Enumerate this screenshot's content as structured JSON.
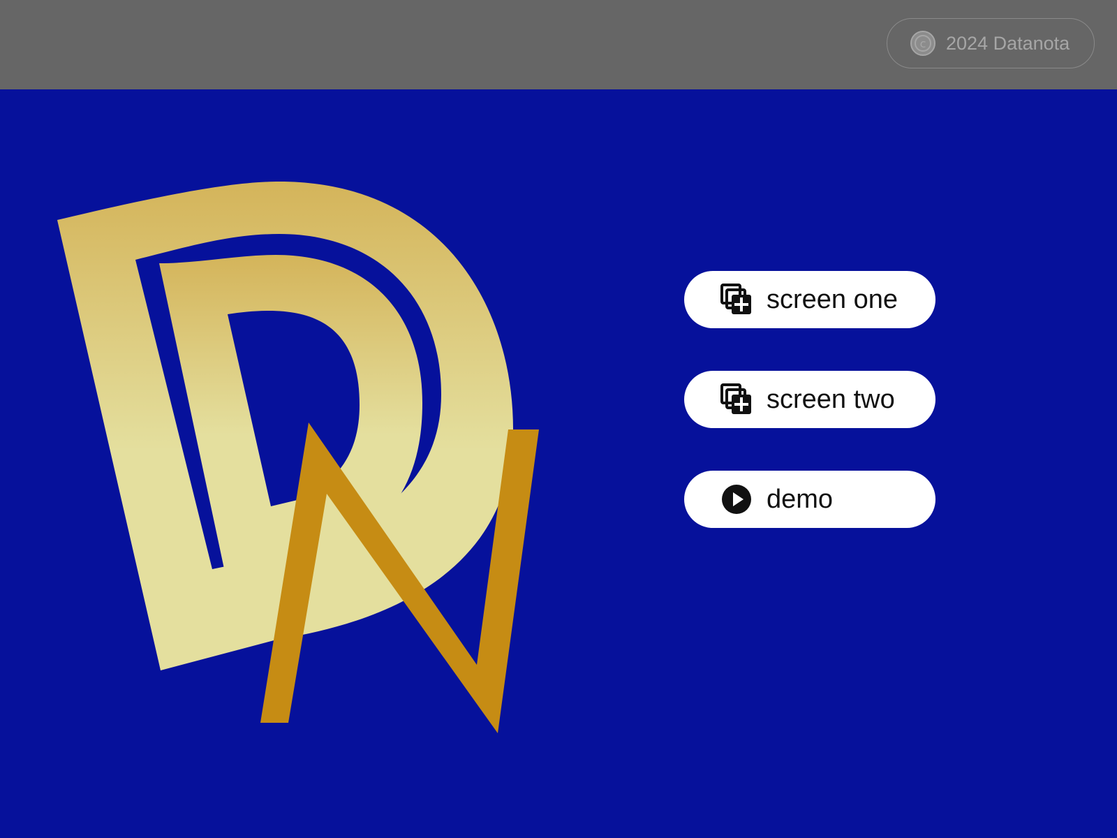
{
  "header": {
    "copyright_text": "2024 Datanota",
    "copyright_icon": "copyright-icon"
  },
  "logo": {
    "letters": "DN",
    "colors": {
      "d_gradient_top": "#d4b45a",
      "d_gradient_bottom": "#e4df9e",
      "n_fill": "#c68c14"
    }
  },
  "menu": {
    "items": [
      {
        "label": "screen one",
        "icon": "add-to-library-icon"
      },
      {
        "label": "screen two",
        "icon": "add-to-library-icon"
      },
      {
        "label": "demo",
        "icon": "play-circle-icon"
      }
    ]
  },
  "colors": {
    "background": "#06119b",
    "topbar": "#666666",
    "button_bg": "#ffffff"
  }
}
